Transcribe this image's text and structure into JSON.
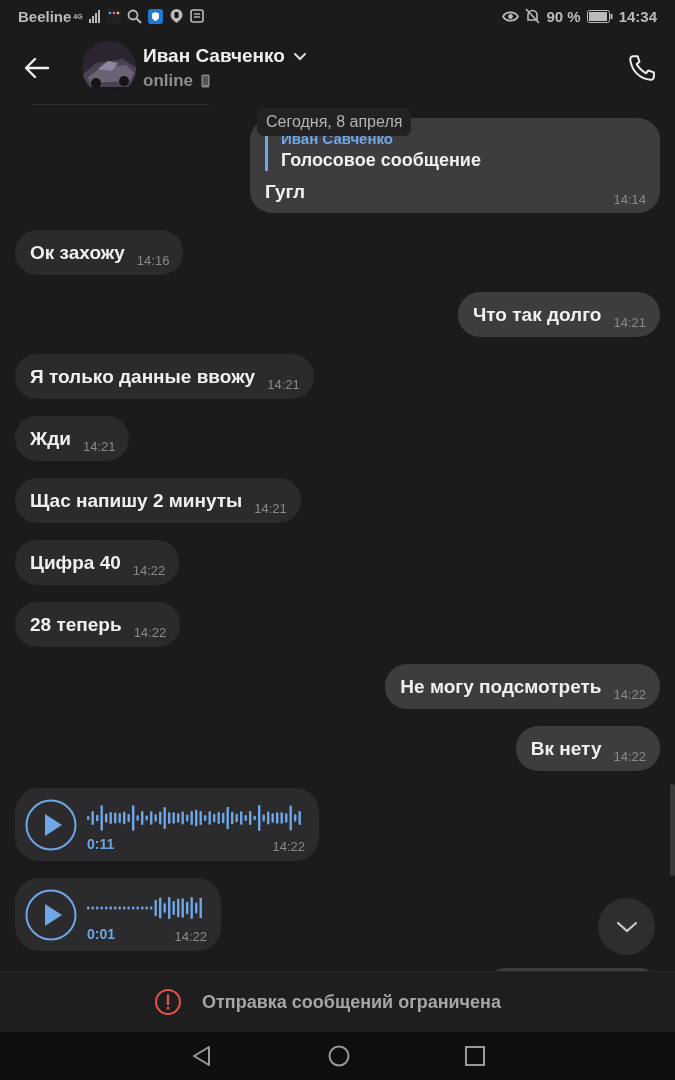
{
  "status_bar": {
    "carrier": "Beeline",
    "network": "4G",
    "battery": "90 %",
    "time": "14:34"
  },
  "header": {
    "name": "Иван Савченко",
    "status": "online"
  },
  "date_pill": "Сегодня, 8 апреля",
  "messages": [
    {
      "kind": "reply",
      "outgoing": true,
      "reply_name": "Иван Савченко",
      "reply_text": "Голосовое сообщение",
      "text": "Гугл",
      "time": "14:14"
    },
    {
      "kind": "text",
      "outgoing": false,
      "text": "Ок захожу",
      "time": "14:16"
    },
    {
      "kind": "text",
      "outgoing": true,
      "text": "Что так долго",
      "time": "14:21"
    },
    {
      "kind": "text",
      "outgoing": false,
      "text": "Я только данные ввожу",
      "time": "14:21"
    },
    {
      "kind": "text",
      "outgoing": false,
      "text": "Жди",
      "time": "14:21"
    },
    {
      "kind": "text",
      "outgoing": false,
      "text": "Щас напишу 2 минуты",
      "time": "14:21"
    },
    {
      "kind": "text",
      "outgoing": false,
      "text": "Цифра 40",
      "time": "14:22"
    },
    {
      "kind": "text",
      "outgoing": false,
      "text": "28 теперь",
      "time": "14:22"
    },
    {
      "kind": "text",
      "outgoing": true,
      "text": "Не могу подсмотреть",
      "time": "14:22"
    },
    {
      "kind": "text",
      "outgoing": true,
      "text": "Вк нету",
      "time": "14:22"
    },
    {
      "kind": "voice",
      "outgoing": false,
      "duration": "0:11",
      "time": "14:22"
    },
    {
      "kind": "voice",
      "outgoing": false,
      "duration": "0:01",
      "time": "14:22"
    },
    {
      "kind": "partial",
      "outgoing": true
    }
  ],
  "notice": "Отправка сообщений ограничена"
}
